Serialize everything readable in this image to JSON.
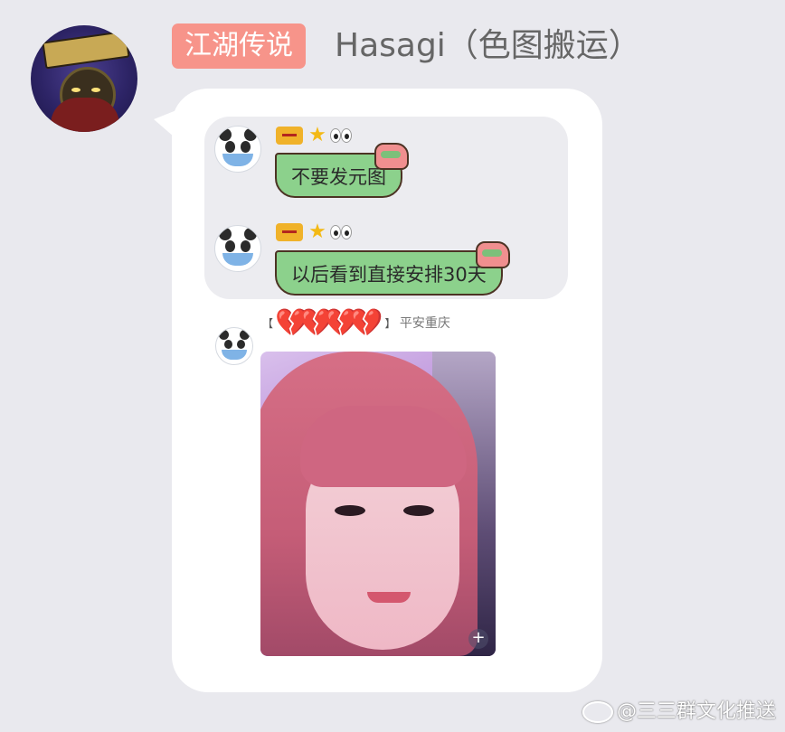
{
  "header": {
    "group_badge": "江湖传说",
    "sender_name": "Hasagi（色图搬运）"
  },
  "quoted_messages": [
    {
      "text": "不要发元图"
    },
    {
      "text": "以后看到直接安排30天"
    }
  ],
  "third_message": {
    "hearts": "💔💔💔💔",
    "title": "平安重庆",
    "open_bracket": "【",
    "close_bracket": "】"
  },
  "photo": {
    "add_label": "+"
  },
  "watermark": {
    "text": "@三三群文化推送"
  },
  "colors": {
    "background": "#e9e9ee",
    "group_badge": "#f7948a",
    "green_bubble": "#8cd18c",
    "bubble_border": "#4c3324"
  }
}
